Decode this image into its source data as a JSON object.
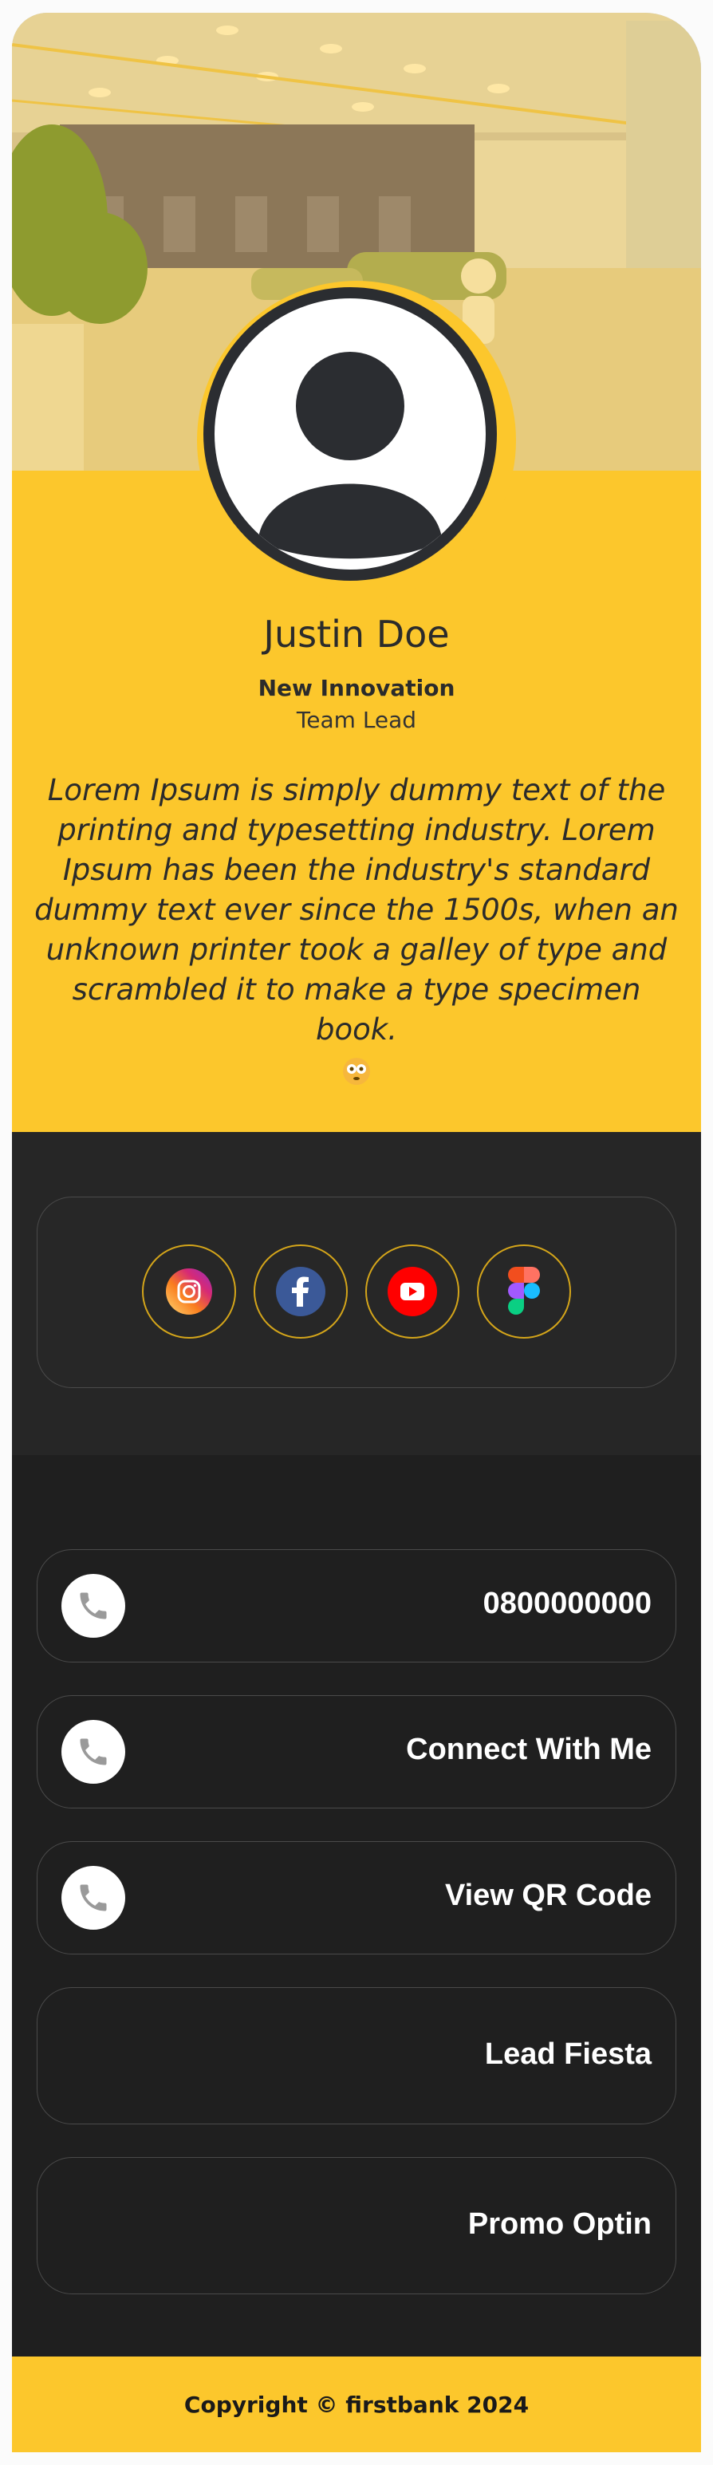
{
  "profile": {
    "name": "Justin Doe",
    "organization": "New Innovation",
    "role": "Team Lead",
    "bio": "Lorem Ipsum is simply dummy text of the printing and typesetting industry. Lorem Ipsum has been the industry's standard dummy text ever since the 1500s, when an unknown printer took a galley of type and scrambled it to make a type specimen book.",
    "bio_emoji_icon": "flushed-face-icon"
  },
  "social": {
    "items": [
      {
        "name": "Instagram",
        "icon": "instagram-icon"
      },
      {
        "name": "Facebook",
        "icon": "facebook-icon"
      },
      {
        "name": "YouTube",
        "icon": "youtube-icon"
      },
      {
        "name": "Figma",
        "icon": "figma-icon"
      }
    ]
  },
  "actions": [
    {
      "label": "0800000000",
      "icon": "phone-icon"
    },
    {
      "label": "Connect With Me",
      "icon": "phone-icon"
    },
    {
      "label": "View QR Code",
      "icon": "phone-icon"
    },
    {
      "label": "Lead Fiesta"
    },
    {
      "label": "Promo Optin"
    }
  ],
  "footer": {
    "copyright": "Copyright © firstbank 2024"
  },
  "colors": {
    "accent": "#fcc72c",
    "dark": "#1f1f1f",
    "dark_alt": "#262626"
  }
}
